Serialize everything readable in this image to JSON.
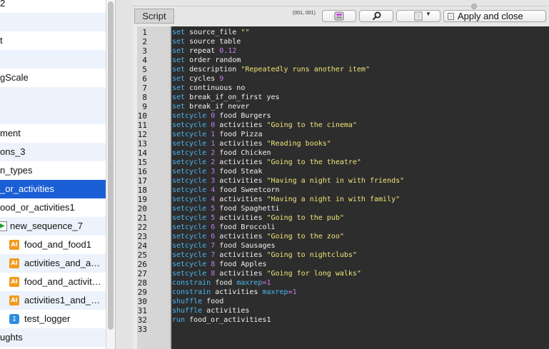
{
  "tree": {
    "items": [
      {
        "label": "2"
      },
      {
        "label": ""
      },
      {
        "label": "t"
      },
      {
        "label": ""
      },
      {
        "label": "gScale"
      },
      {
        "label": ""
      },
      {
        "label": "ment"
      },
      {
        "label": "ons_3"
      },
      {
        "label": "n_types"
      },
      {
        "label": "_or_activities"
      },
      {
        "label": "ood_or_activities1"
      },
      {
        "label": "new_sequence_7"
      },
      {
        "label": "food_and_food1"
      },
      {
        "label": "activities_and_a…"
      },
      {
        "label": "food_and_activit…"
      },
      {
        "label": "activities1_and_…"
      },
      {
        "label": "test_logger"
      },
      {
        "label": "ughts"
      }
    ],
    "selected_index": 9,
    "ai_icon_text": "AI"
  },
  "toolbar": {
    "tab_label": "Script",
    "coords": "(001, 001)",
    "apply_label": "Apply and close"
  },
  "editor": {
    "lines": [
      [
        [
          "kw",
          "set"
        ],
        [
          "t",
          " source_file "
        ],
        [
          "str",
          "\"\""
        ]
      ],
      [
        [
          "kw",
          "set"
        ],
        [
          "t",
          " source table"
        ]
      ],
      [
        [
          "kw",
          "set"
        ],
        [
          "t",
          " repeat "
        ],
        [
          "num",
          "0.12"
        ]
      ],
      [
        [
          "kw",
          "set"
        ],
        [
          "t",
          " order random"
        ]
      ],
      [
        [
          "kw",
          "set"
        ],
        [
          "t",
          " description "
        ],
        [
          "str",
          "\"Repeatedly runs another item\""
        ]
      ],
      [
        [
          "kw",
          "set"
        ],
        [
          "t",
          " cycles "
        ],
        [
          "num",
          "9"
        ]
      ],
      [
        [
          "kw",
          "set"
        ],
        [
          "t",
          " continuous no"
        ]
      ],
      [
        [
          "kw",
          "set"
        ],
        [
          "t",
          " break_if_on_first yes"
        ]
      ],
      [
        [
          "kw",
          "set"
        ],
        [
          "t",
          " break_if never"
        ]
      ],
      [
        [
          "kw",
          "setcycle"
        ],
        [
          "t",
          " "
        ],
        [
          "num",
          "0"
        ],
        [
          "t",
          " food Burgers"
        ]
      ],
      [
        [
          "kw",
          "setcycle"
        ],
        [
          "t",
          " "
        ],
        [
          "num",
          "0"
        ],
        [
          "t",
          " activities "
        ],
        [
          "str",
          "\"Going to the cinema\""
        ]
      ],
      [
        [
          "kw",
          "setcycle"
        ],
        [
          "t",
          " "
        ],
        [
          "num",
          "1"
        ],
        [
          "t",
          " food Pizza"
        ]
      ],
      [
        [
          "kw",
          "setcycle"
        ],
        [
          "t",
          " "
        ],
        [
          "num",
          "1"
        ],
        [
          "t",
          " activities "
        ],
        [
          "str",
          "\"Reading books\""
        ]
      ],
      [
        [
          "kw",
          "setcycle"
        ],
        [
          "t",
          " "
        ],
        [
          "num",
          "2"
        ],
        [
          "t",
          " food Chicken"
        ]
      ],
      [
        [
          "kw",
          "setcycle"
        ],
        [
          "t",
          " "
        ],
        [
          "num",
          "2"
        ],
        [
          "t",
          " activities "
        ],
        [
          "str",
          "\"Going to the theatre\""
        ]
      ],
      [
        [
          "kw",
          "setcycle"
        ],
        [
          "t",
          " "
        ],
        [
          "num",
          "3"
        ],
        [
          "t",
          " food Steak"
        ]
      ],
      [
        [
          "kw",
          "setcycle"
        ],
        [
          "t",
          " "
        ],
        [
          "num",
          "3"
        ],
        [
          "t",
          " activities "
        ],
        [
          "str",
          "\"Having a night in with friends\""
        ]
      ],
      [
        [
          "kw",
          "setcycle"
        ],
        [
          "t",
          " "
        ],
        [
          "num",
          "4"
        ],
        [
          "t",
          " food Sweetcorn"
        ]
      ],
      [
        [
          "kw",
          "setcycle"
        ],
        [
          "t",
          " "
        ],
        [
          "num",
          "4"
        ],
        [
          "t",
          " activities "
        ],
        [
          "str",
          "\"Having a night in with family\""
        ]
      ],
      [
        [
          "kw",
          "setcycle"
        ],
        [
          "t",
          " "
        ],
        [
          "num",
          "5"
        ],
        [
          "t",
          " food Spaghetti"
        ]
      ],
      [
        [
          "kw",
          "setcycle"
        ],
        [
          "t",
          " "
        ],
        [
          "num",
          "5"
        ],
        [
          "t",
          " activities "
        ],
        [
          "str",
          "\"Going to the pub\""
        ]
      ],
      [
        [
          "kw",
          "setcycle"
        ],
        [
          "t",
          " "
        ],
        [
          "num",
          "6"
        ],
        [
          "t",
          " food Broccoli"
        ]
      ],
      [
        [
          "kw",
          "setcycle"
        ],
        [
          "t",
          " "
        ],
        [
          "num",
          "6"
        ],
        [
          "t",
          " activities "
        ],
        [
          "str",
          "\"Going to the zoo\""
        ]
      ],
      [
        [
          "kw",
          "setcycle"
        ],
        [
          "t",
          " "
        ],
        [
          "num",
          "7"
        ],
        [
          "t",
          " food Sausages"
        ]
      ],
      [
        [
          "kw",
          "setcycle"
        ],
        [
          "t",
          " "
        ],
        [
          "num",
          "7"
        ],
        [
          "t",
          " activities "
        ],
        [
          "str",
          "\"Going to nightclubs\""
        ]
      ],
      [
        [
          "kw",
          "setcycle"
        ],
        [
          "t",
          " "
        ],
        [
          "num",
          "8"
        ],
        [
          "t",
          " food Apples"
        ]
      ],
      [
        [
          "kw",
          "setcycle"
        ],
        [
          "t",
          " "
        ],
        [
          "num",
          "8"
        ],
        [
          "t",
          " activities "
        ],
        [
          "str",
          "\"Going for long walks\""
        ]
      ],
      [
        [
          "kw",
          "constrain"
        ],
        [
          "t",
          " food "
        ],
        [
          "kw",
          "maxrep"
        ],
        [
          "op",
          "="
        ],
        [
          "num",
          "1"
        ]
      ],
      [
        [
          "kw",
          "constrain"
        ],
        [
          "t",
          " activities "
        ],
        [
          "kw",
          "maxrep"
        ],
        [
          "op",
          "="
        ],
        [
          "num",
          "1"
        ]
      ],
      [
        [
          "kw",
          "shuffle"
        ],
        [
          "t",
          " food"
        ]
      ],
      [
        [
          "kw",
          "shuffle"
        ],
        [
          "t",
          " activities"
        ]
      ],
      [
        [
          "kw",
          "run"
        ],
        [
          "t",
          " food_or_activities1"
        ]
      ],
      []
    ]
  },
  "colors": {
    "keyword": "#4ab6f0",
    "number": "#c07ff0",
    "string": "#f0e47a",
    "selection": "#1a5fd6",
    "editor_bg": "#2d2d2d"
  }
}
